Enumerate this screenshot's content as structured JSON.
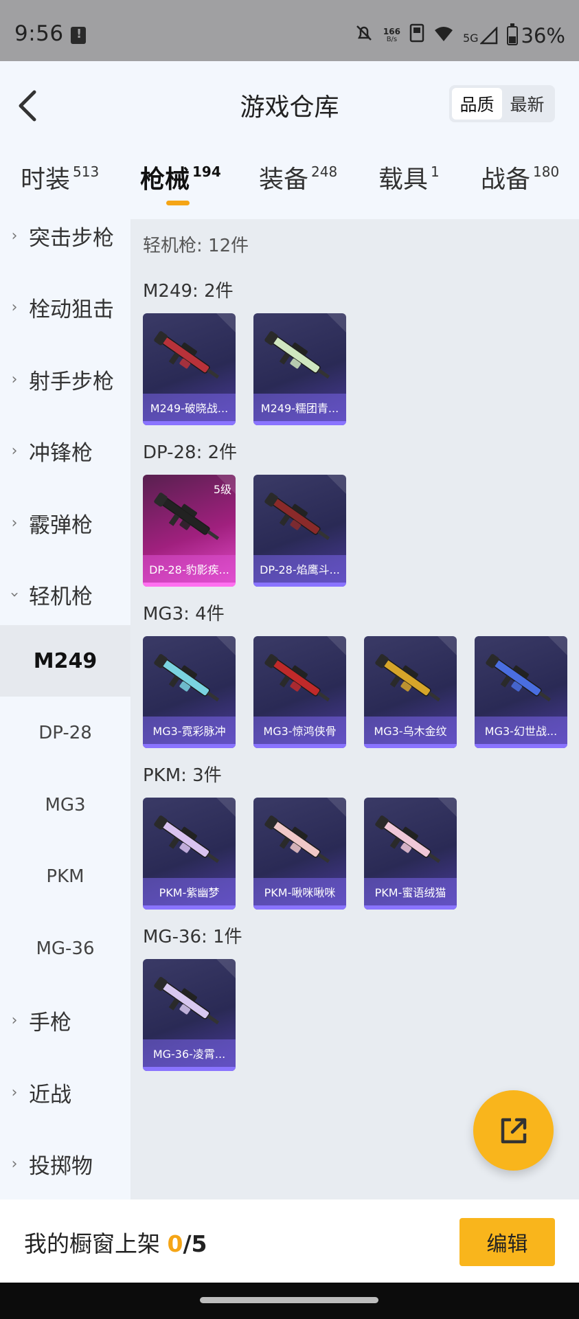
{
  "status_bar": {
    "time": "9:56",
    "net_speed_value": "166",
    "net_speed_unit": "B/s",
    "network": "5G",
    "battery": "36%"
  },
  "header": {
    "title": "游戏仓库",
    "sort_options": [
      "品质",
      "最新"
    ],
    "sort_selected": "品质"
  },
  "tabs": [
    {
      "label": "时装",
      "count": "513"
    },
    {
      "label": "枪械",
      "count": "194",
      "active": true
    },
    {
      "label": "装备",
      "count": "248"
    },
    {
      "label": "载具",
      "count": "1"
    },
    {
      "label": "战备",
      "count": "180"
    }
  ],
  "sidebar": {
    "categories_top": [
      "突击步枪",
      "栓动狙击",
      "射手步枪",
      "冲锋枪",
      "霰弹枪",
      "轻机枪"
    ],
    "expanded": "轻机枪",
    "subitems": [
      "M249",
      "DP-28",
      "MG3",
      "PKM",
      "MG-36"
    ],
    "active_sub": "M249",
    "categories_bottom": [
      "手枪",
      "近战",
      "投掷物"
    ]
  },
  "main": {
    "total_label": "轻机枪: 12件",
    "groups": [
      {
        "title": "M249: 2件",
        "items": [
          {
            "name": "M249-破晓战...",
            "color": "#b8323a"
          },
          {
            "name": "M249-糯团青...",
            "color": "#cfe6c0"
          }
        ]
      },
      {
        "title": "DP-28: 2件",
        "items": [
          {
            "name": "DP-28-豹影疾...",
            "color": "#222222",
            "level": "5级",
            "rarity": "pink"
          },
          {
            "name": "DP-28-焰鹰斗...",
            "color": "#8a2a2a"
          }
        ]
      },
      {
        "title": "MG3: 4件",
        "items": [
          {
            "name": "MG3-霓彩脉冲",
            "color": "#7ad3e0"
          },
          {
            "name": "MG3-惊鸿侠骨",
            "color": "#c02a2a"
          },
          {
            "name": "MG3-乌木金纹",
            "color": "#d6a52a"
          },
          {
            "name": "MG3-幻世战...",
            "color": "#4a6ee0"
          }
        ]
      },
      {
        "title": "PKM: 3件",
        "items": [
          {
            "name": "PKM-紫幽梦",
            "color": "#d9c2f0"
          },
          {
            "name": "PKM-啾咪啾咪",
            "color": "#f0c8c8"
          },
          {
            "name": "PKM-蜜语绒猫",
            "color": "#f0c8d8"
          }
        ]
      },
      {
        "title": "MG-36: 1件",
        "items": [
          {
            "name": "MG-36-凌霄...",
            "color": "#d8c8f0"
          }
        ]
      }
    ]
  },
  "bottom": {
    "showcase_label": "我的橱窗上架 ",
    "showcase_count": "0",
    "showcase_total": "/5",
    "edit_label": "编辑"
  }
}
